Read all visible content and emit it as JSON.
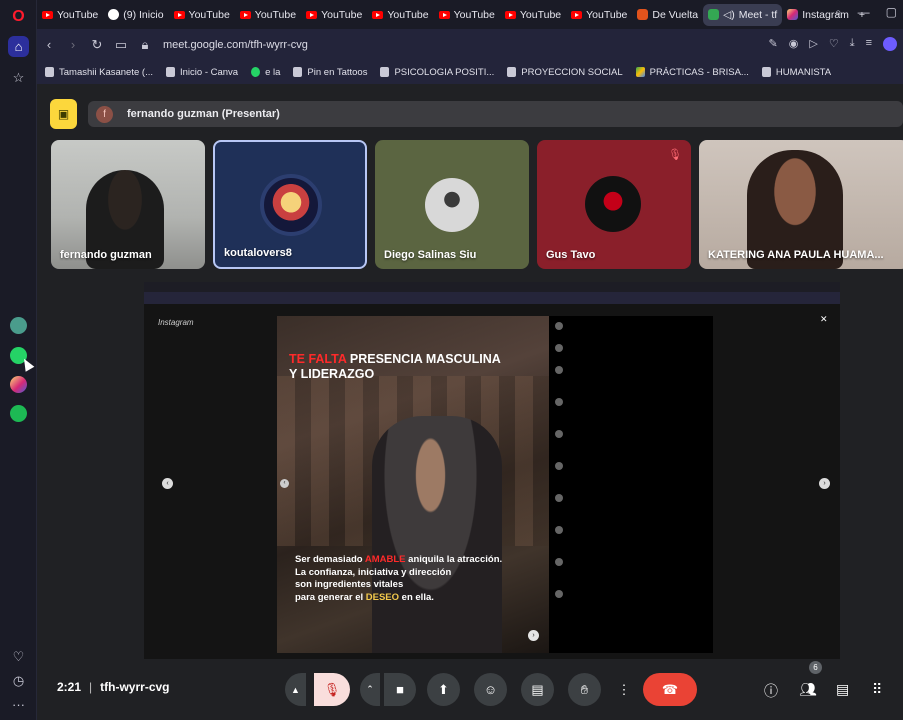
{
  "browser": {
    "tabs": [
      {
        "label": "YouTube",
        "icon": "youtube-icon"
      },
      {
        "label": "(9) Inicio",
        "icon": "threads-icon"
      },
      {
        "label": "YouTube",
        "icon": "youtube-icon"
      },
      {
        "label": "YouTube",
        "icon": "youtube-icon"
      },
      {
        "label": "YouTube",
        "icon": "youtube-icon"
      },
      {
        "label": "YouTube",
        "icon": "youtube-icon"
      },
      {
        "label": "YouTube",
        "icon": "youtube-icon"
      },
      {
        "label": "YouTube",
        "icon": "youtube-icon"
      },
      {
        "label": "YouTube",
        "icon": "youtube-icon"
      },
      {
        "label": "De Vuelta",
        "icon": "app-icon"
      },
      {
        "label": "Meet - tf",
        "icon": "meet-icon",
        "active": true
      },
      {
        "label": "Instagram",
        "icon": "instagram-icon"
      }
    ],
    "url": "meet.google.com/tfh-wyrr-cvg",
    "bookmarks": [
      {
        "label": "Tamashii Kasanete (..."
      },
      {
        "label": "Inicio - Canva"
      },
      {
        "label": "e la"
      },
      {
        "label": "Pin en Tattoos"
      },
      {
        "label": "PSICOLOGIA POSITI..."
      },
      {
        "label": "PROYECCION SOCIAL"
      },
      {
        "label": "PRÁCTICAS - BRISA..."
      },
      {
        "label": "HUMANISTA"
      }
    ]
  },
  "meet": {
    "presenter_avatar": "f",
    "presenter_label": "fernando guzman (Presentar)",
    "participants": [
      {
        "name": "fernando guzman"
      },
      {
        "name": "koutalovers8"
      },
      {
        "name": "Diego Salinas Siu"
      },
      {
        "name": "Gus Tavo"
      },
      {
        "name": "KATERING ANA PAULA HUAMA..."
      }
    ],
    "time": "2:21",
    "meeting_code": "tfh-wyrr-cvg",
    "people_count": "6"
  },
  "shared_screen": {
    "post_headline_red": "TE FALTA",
    "post_headline_white": "PRESENCIA MASCULINA",
    "post_headline_line2": "Y LIDERAZGO",
    "post_body_1a": "Ser demasiado ",
    "post_body_1b": "AMABLE",
    "post_body_1c": " aniquila la atracción.",
    "post_body_2": "La confianza, iniciativa y dirección",
    "post_body_3": "son ingredientes vitales",
    "post_body_4a": "para generar el ",
    "post_body_4b": "DESEO",
    "post_body_4c": " en ella.",
    "ig_logo": "Instagram"
  },
  "colors": {
    "accent": "#2c2f9c",
    "end_call": "#ea4335",
    "present_icon": "#fcd73c"
  }
}
